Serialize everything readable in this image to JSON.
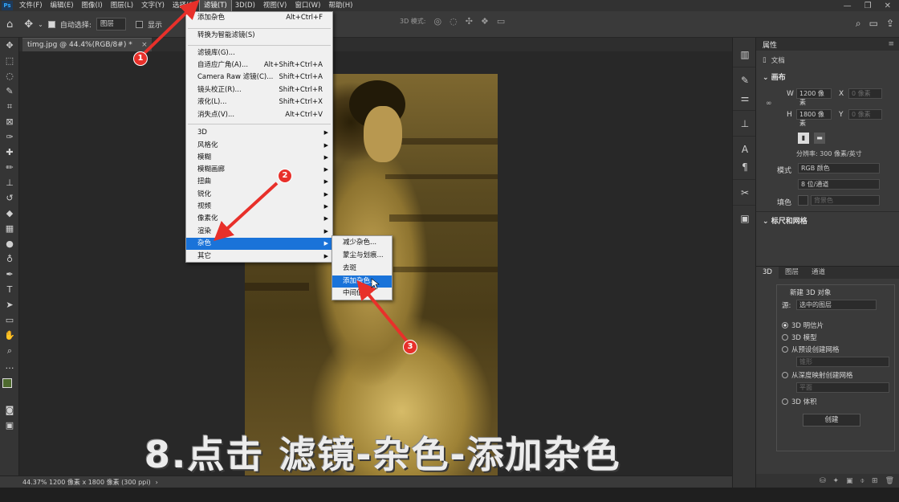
{
  "app_logo": "Ps",
  "menubar": {
    "items": [
      "文件(F)",
      "编辑(E)",
      "图像(I)",
      "图层(L)",
      "文字(Y)",
      "选择(S)",
      "滤镜(T)",
      "3D(D)",
      "视图(V)",
      "窗口(W)",
      "帮助(H)"
    ],
    "active": "滤镜(T)"
  },
  "options_bar": {
    "auto_select_label": "自动选择:",
    "auto_select_value": "图层",
    "show_transform_label": "显示",
    "mode_3d_label": "3D 模式:"
  },
  "document_tab": {
    "title": "timg.jpg @ 44.4%(RGB/8#) *",
    "close": "×"
  },
  "status_bar": {
    "zoom": "44.37%",
    "info": "1200 像素 x 1800 像素 (300 ppi)"
  },
  "caption": "8.点击  滤镜-杂色-添加杂色",
  "filter_menu": {
    "last_filter": {
      "label": "添加杂色",
      "shortcut": "Alt+Ctrl+F"
    },
    "convert_smart": "转换为智能滤镜(S)",
    "group1": [
      {
        "label": "滤镜库(G)...",
        "shortcut": ""
      },
      {
        "label": "自适应广角(A)...",
        "shortcut": "Alt+Shift+Ctrl+A"
      },
      {
        "label": "Camera Raw 滤镜(C)...",
        "shortcut": "Shift+Ctrl+A"
      },
      {
        "label": "镜头校正(R)...",
        "shortcut": "Shift+Ctrl+R"
      },
      {
        "label": "液化(L)...",
        "shortcut": "Shift+Ctrl+X"
      },
      {
        "label": "消失点(V)...",
        "shortcut": "Alt+Ctrl+V"
      }
    ],
    "group2": [
      "3D",
      "风格化",
      "模糊",
      "模糊画廊",
      "扭曲",
      "锐化",
      "视频",
      "像素化",
      "渲染",
      "杂色",
      "其它"
    ],
    "highlighted": "杂色"
  },
  "noise_submenu": {
    "items": [
      "减少杂色...",
      "蒙尘与划痕...",
      "去斑",
      "添加杂色...",
      "中间值..."
    ],
    "highlighted": "添加杂色..."
  },
  "markers": [
    "1",
    "2",
    "3"
  ],
  "properties_panel": {
    "title": "属性",
    "doc_label": "文档",
    "canvas_section": "画布",
    "w_label": "W",
    "w_value": "1200 像素",
    "h_label": "H",
    "h_value": "1800 像素",
    "x_label": "X",
    "x_value": "0 像素",
    "y_label": "Y",
    "y_value": "0 像素",
    "resolution": "分辨率: 300 像素/英寸",
    "mode_label": "模式",
    "mode_value": "RGB 颜色",
    "depth_value": "8 位/通道",
    "fill_label": "填色",
    "fill_value": "背景色",
    "rulers_section": "标尺和网格"
  },
  "panel_3d": {
    "tabs": [
      "3D",
      "图层",
      "通道"
    ],
    "active_tab": "3D",
    "new_object_label": "新建 3D 对象",
    "source_label": "源:",
    "source_value": "选中的图层",
    "options": [
      "3D 明信片",
      "3D 模型",
      "从预设创建网格",
      "从深度映射创建网格",
      "3D 体积"
    ],
    "selected_option": "3D 明信片",
    "preset_value": "锥形",
    "depth_map_value": "平面",
    "create_button": "创建"
  },
  "colors": {
    "menu_highlight": "#1a73d9",
    "marker": "#e8302a",
    "bg_dark": "#282828",
    "panel": "#3a3a3a"
  }
}
